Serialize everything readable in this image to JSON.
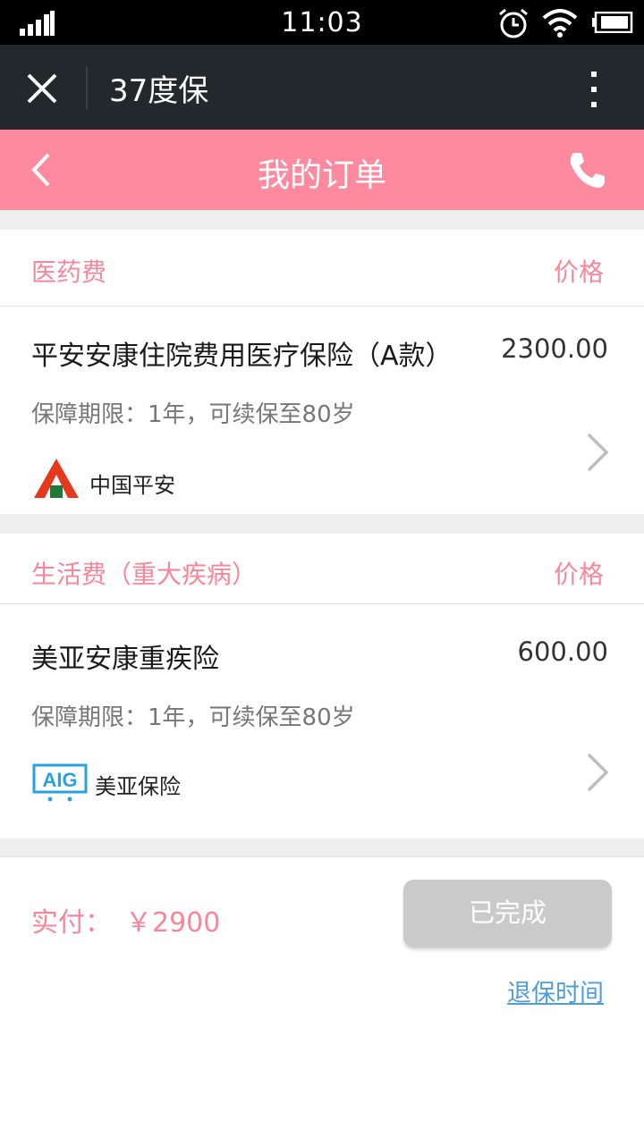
{
  "status_bar": {
    "time": "11:03",
    "icons": [
      "signal-icon",
      "alarm-icon",
      "wifi-icon",
      "battery-icon"
    ]
  },
  "app_bar": {
    "title": "37度保",
    "icons": [
      "close-icon",
      "more-icon"
    ]
  },
  "header": {
    "title": "我的订单",
    "icons": [
      "back-icon",
      "phone-icon"
    ]
  },
  "sections": [
    {
      "category": "医药费",
      "price_label": "价格",
      "item": {
        "name": "平安安康住院费用医疗保险（A款）",
        "amount": "2300.00",
        "term": "保障期限：1年，可续保至80岁",
        "company": "中国平安",
        "logo_icon": "ping-an-logo-icon"
      }
    },
    {
      "category": "生活费（重大疾病）",
      "price_label": "价格",
      "item": {
        "name": "美亚安康重疾险",
        "amount": "600.00",
        "term": "保障期限：1年，可续保至80岁",
        "company": "美亚保险",
        "logo_icon": "aig-logo-icon",
        "logo_text": "AIG"
      }
    }
  ],
  "footer": {
    "paid_label": "实付：",
    "paid_amount": "￥2900",
    "done_button": "已完成",
    "refund_link": "退保时间"
  },
  "colors": {
    "brand_pink": "#fe8a9f",
    "accent_text_pink": "#f7869a",
    "app_bar": "#23282c",
    "link_blue": "#4f9ed8",
    "disabled_button": "#cacaca"
  }
}
